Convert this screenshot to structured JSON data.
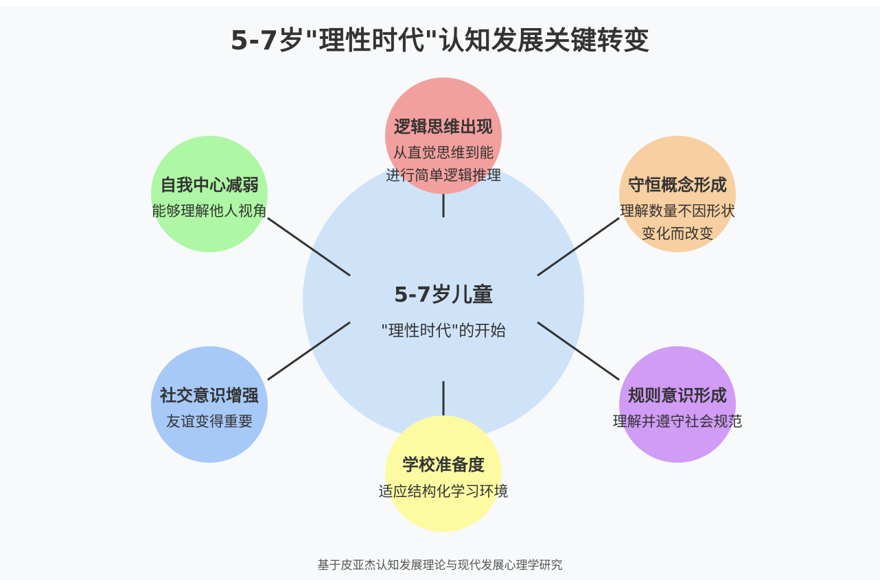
{
  "title": "5-7岁\"理性时代\"认知发展关键转变",
  "center": {
    "title": "5-7岁儿童",
    "subtitle": "\"理性时代\"的开始",
    "color": "#cfe3f8"
  },
  "nodes": [
    {
      "title": "逻辑思维出现",
      "desc_lines": [
        "从直觉思维到能",
        "进行简单逻辑推理"
      ],
      "color": "#f2a09e"
    },
    {
      "title": "守恒概念形成",
      "desc_lines": [
        "理解数量不因形状",
        "变化而改变"
      ],
      "color": "#f7cfa0"
    },
    {
      "title": "规则意识形成",
      "desc_lines": [
        "理解并遵守社会规范"
      ],
      "color": "#d09cf5"
    },
    {
      "title": "学校准备度",
      "desc_lines": [
        "适应结构化学习环境"
      ],
      "color": "#fdfba2"
    },
    {
      "title": "社交意识增强",
      "desc_lines": [
        "友谊变得重要"
      ],
      "color": "#a6c9f7"
    },
    {
      "title": "自我中心减弱",
      "desc_lines": [
        "能够理解他人视角"
      ],
      "color": "#aef7a4"
    }
  ],
  "footer": "基于皮亚杰认知发展理论与现代发展心理学研究",
  "colors": {
    "background": "#f7f9fb",
    "connector": "#333333",
    "text": "#333333"
  }
}
